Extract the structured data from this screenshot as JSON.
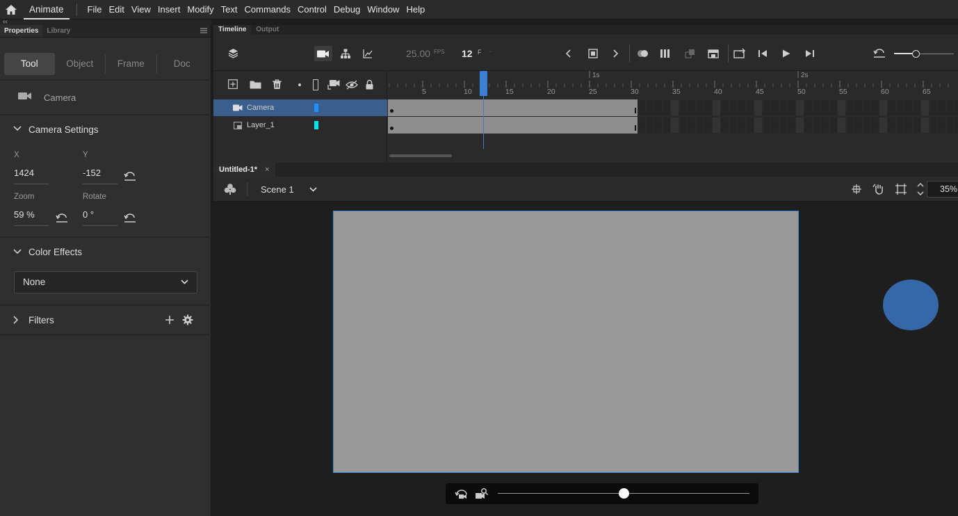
{
  "app": {
    "name": "Animate"
  },
  "menu": [
    "File",
    "Edit",
    "View",
    "Insert",
    "Modify",
    "Text",
    "Commands",
    "Control",
    "Debug",
    "Window",
    "Help"
  ],
  "left_panel": {
    "collapse_glyph": "‹‹",
    "tabs": [
      "Properties",
      "Library"
    ],
    "segments": [
      "Tool",
      "Object",
      "Frame",
      "Doc"
    ],
    "tool_name": "Camera",
    "camera_settings": {
      "title": "Camera Settings",
      "x_label": "X",
      "x_value": "1424",
      "y_label": "Y",
      "y_value": "-152",
      "zoom_label": "Zoom",
      "zoom_value": "59 %",
      "rotate_label": "Rotate",
      "rotate_value": "0 °"
    },
    "color_effects": {
      "title": "Color Effects",
      "value": "None"
    },
    "filters": {
      "title": "Filters"
    }
  },
  "timeline": {
    "tabs": [
      "Timeline",
      "Output"
    ],
    "fps_value": "25.00",
    "fps_unit": "FPS",
    "frame_value": "12",
    "frame_unit": "F",
    "seconds": [
      "1s",
      "2s"
    ],
    "ticks": [
      "5",
      "10",
      "15",
      "20",
      "25",
      "30",
      "35",
      "40",
      "45",
      "50",
      "55",
      "60",
      "65"
    ],
    "current_frame": 12,
    "layers": [
      {
        "name": "Camera",
        "color": "#1e90ff",
        "selected": true
      },
      {
        "name": "Layer_1",
        "color": "#00e5ee",
        "selected": false
      }
    ]
  },
  "document": {
    "tab": "Untitled-1*",
    "close_glyph": "×",
    "scene": "Scene 1",
    "zoom": "35%",
    "camera_zoom_slider": 0.5
  },
  "colors": {
    "accent": "#3b8be0",
    "stage": "#999999",
    "circle": "#3468a8",
    "selected_layer": "#3a5f8e"
  }
}
